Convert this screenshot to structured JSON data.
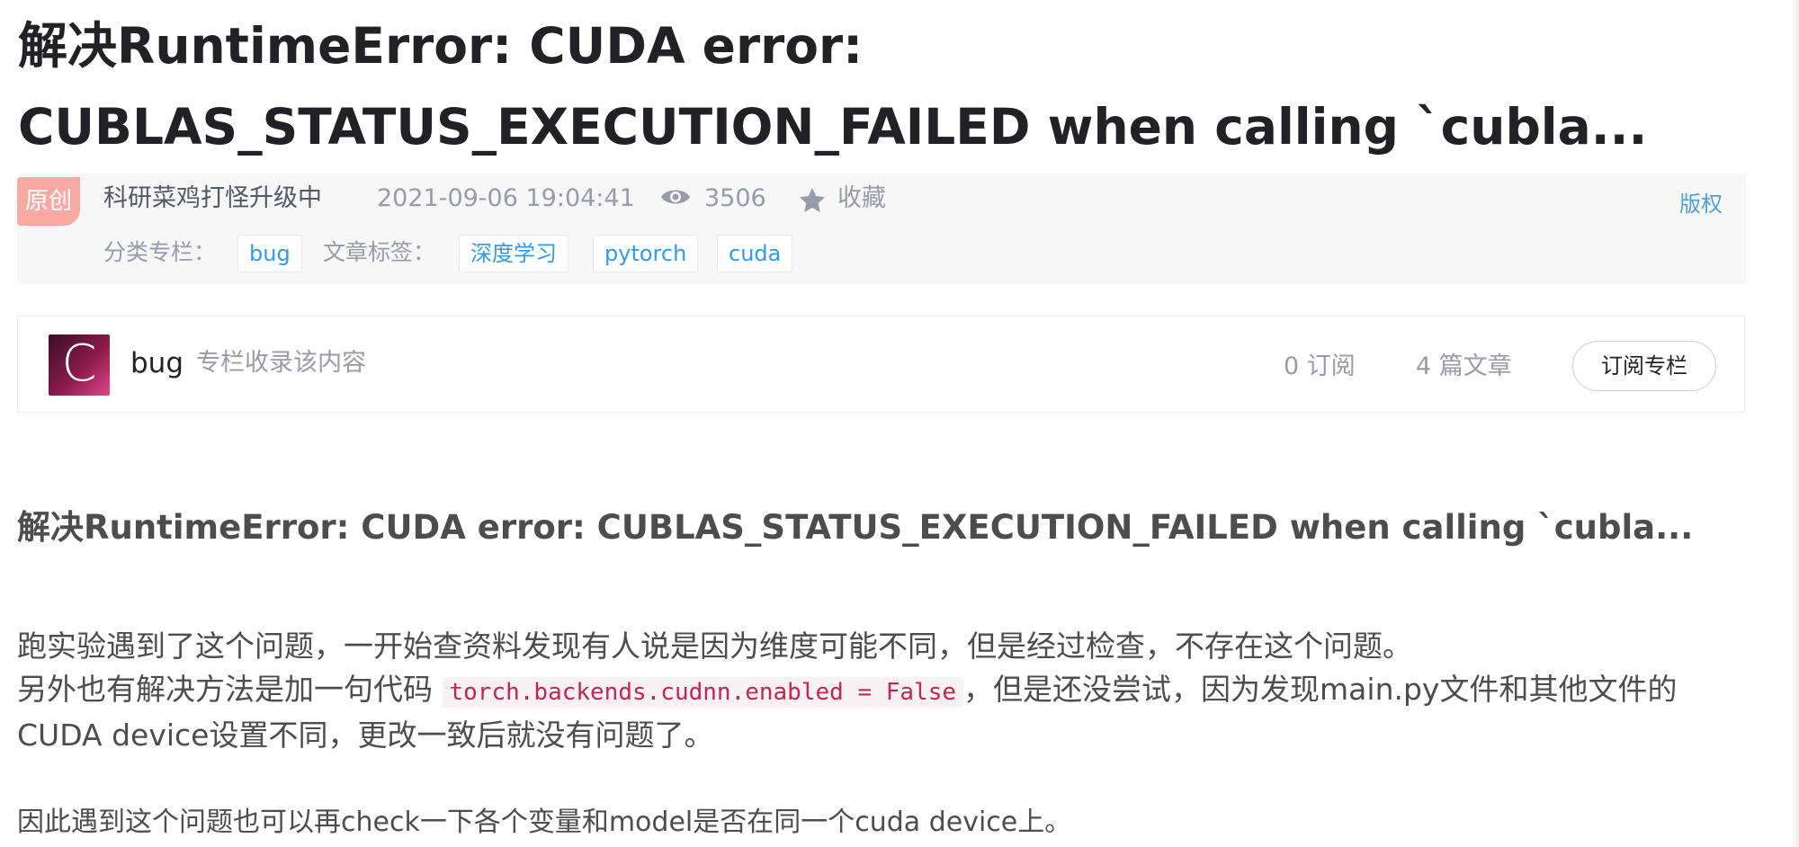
{
  "article": {
    "title": "解决RuntimeError: CUDA error: CUBLAS_STATUS_EXECUTION_FAILED when calling `cubla...",
    "badge": "原创",
    "author": "科研菜鸡打怪升级中",
    "datetime": "2021-09-06 19:04:41",
    "views": "3506",
    "collect_label": "收藏",
    "copyright_label": "版权",
    "category_label": "分类专栏：",
    "category": "bug",
    "tags_label": "文章标签：",
    "tags": [
      "深度学习",
      "pytorch",
      "cuda"
    ]
  },
  "column": {
    "avatar_letter": "C",
    "name": "bug",
    "description": "专栏收录该内容",
    "subscribers": "0 订阅",
    "articles": "4 篇文章",
    "subscribe_button": "订阅专栏"
  },
  "content": {
    "heading": "解决RuntimeError: CUDA error: CUBLAS_STATUS_EXECUTION_FAILED when calling `cubla...",
    "p1_line1": "跑实验遇到了这个问题，一开始查资料发现有人说是因为维度可能不同，但是经过检查，不存在这个问题。",
    "p1_line2_start": "另外也有解决方法是加一句代码 ",
    "p1_code": "torch.backends.cudnn.enabled = False",
    "p1_line2_end": "，但是还没尝试，因为发现main.py文件和其他文件的CUDA device设置不同，更改一致后就没有问题了。",
    "p2": "因此遇到这个问题也可以再check一下各个变量和model是否在同一个cuda device上。"
  },
  "colors": {
    "link": "#3399ea",
    "badge_bg": "#f8a9a4",
    "meta_bg": "#f7f7f8",
    "code_text": "#c7254e"
  },
  "icons": {
    "views": "eye-icon",
    "collect": "star-icon"
  }
}
